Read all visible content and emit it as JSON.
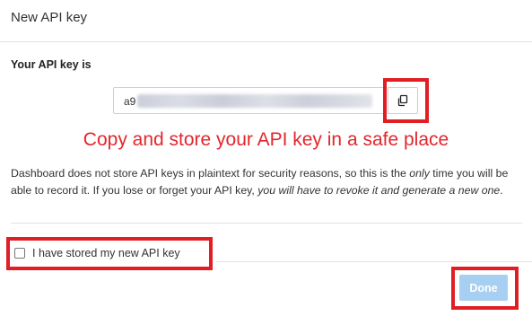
{
  "dialog": {
    "title": "New API key"
  },
  "key": {
    "heading": "Your API key is",
    "visible_prefix": "a9"
  },
  "icons": {
    "copy": "copy-icon"
  },
  "warning": {
    "text": "Copy and store your API key in a safe place"
  },
  "description": {
    "part1": "Dashboard does not store API keys in plaintext for security reasons, so this is the ",
    "part2_emph": "only",
    "part3": " time you will be able to record it. If you lose or forget your API key, ",
    "part4_emph": "you will have to revoke it and generate a new one",
    "part5": "."
  },
  "confirm": {
    "label": "I have stored my new API key",
    "checked": false
  },
  "footer": {
    "done_label": "Done",
    "done_enabled": false
  },
  "colors": {
    "highlight_border": "#e01e24",
    "warning_text": "#e3262c",
    "done_disabled_bg": "#a7cff2"
  }
}
